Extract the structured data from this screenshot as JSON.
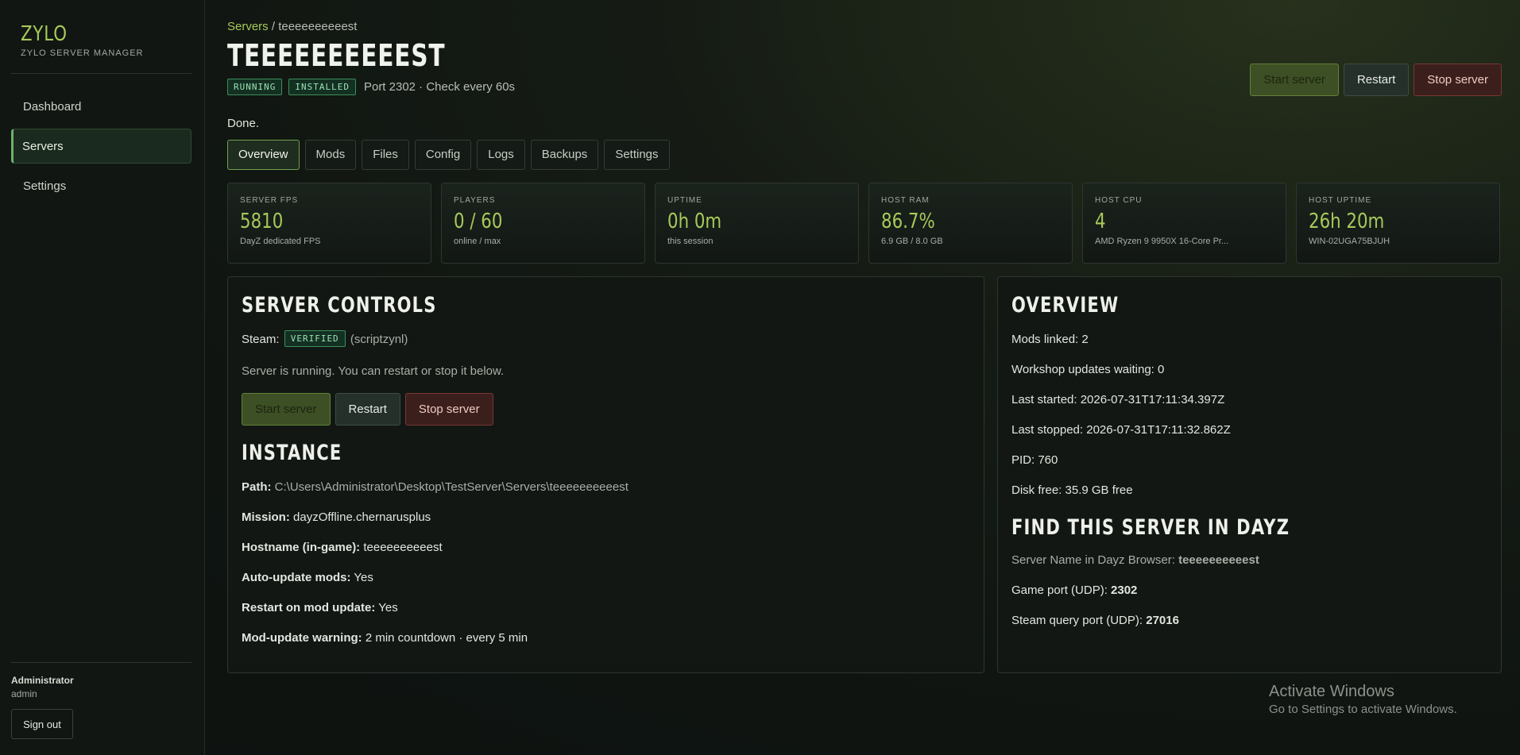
{
  "brand": {
    "name": "ZYLO",
    "subtitle": "ZYLO SERVER MANAGER"
  },
  "sidebar": {
    "items": [
      {
        "label": "Dashboard",
        "active": false
      },
      {
        "label": "Servers",
        "active": true
      },
      {
        "label": "Settings",
        "active": false
      }
    ]
  },
  "user": {
    "name": "Administrator",
    "role": "admin",
    "signout_label": "Sign out"
  },
  "breadcrumb": {
    "root": "Servers",
    "sep": "/",
    "current": "teeeeeeeeeest"
  },
  "server": {
    "title": "TEEEEEEEEEEST",
    "badges": [
      "RUNNING",
      "INSTALLED"
    ],
    "port_info": "Port 2302 · Check every 60s"
  },
  "actions": {
    "start": "Start server",
    "restart": "Restart",
    "stop": "Stop server"
  },
  "status_message": "Done.",
  "tabs": [
    "Overview",
    "Mods",
    "Files",
    "Config",
    "Logs",
    "Backups",
    "Settings"
  ],
  "stats": [
    {
      "label": "SERVER FPS",
      "value": "5810",
      "sub": "DayZ dedicated FPS"
    },
    {
      "label": "PLAYERS",
      "value": "0 / 60",
      "sub": "online / max"
    },
    {
      "label": "UPTIME",
      "value": "0h 0m",
      "sub": "this session"
    },
    {
      "label": "HOST RAM",
      "value": "86.7%",
      "sub": "6.9 GB / 8.0 GB"
    },
    {
      "label": "HOST CPU",
      "value": "4",
      "sub": "AMD Ryzen 9 9950X 16-Core Pr..."
    },
    {
      "label": "HOST UPTIME",
      "value": "26h 20m",
      "sub": "WIN-02UGA75BJUH"
    }
  ],
  "controls": {
    "heading": "SERVER CONTROLS",
    "steam_label": "Steam:",
    "steam_badge": "VERIFIED",
    "steam_user": "(scriptzynl)",
    "message": "Server is running. You can restart or stop it below."
  },
  "instance": {
    "heading": "INSTANCE",
    "path_label": "Path:",
    "path": "C:\\Users\\Administrator\\Desktop\\TestServer\\Servers\\teeeeeeeeeest",
    "mission_label": "Mission:",
    "mission": "dayzOffline.chernarusplus",
    "hostname_label": "Hostname (in-game):",
    "hostname": "teeeeeeeeeest",
    "autoupdate_label": "Auto-update mods:",
    "autoupdate": "Yes",
    "restart_label": "Restart on mod update:",
    "restart": "Yes",
    "warning_label": "Mod-update warning:",
    "warning": "2 min countdown · every 5 min"
  },
  "overview": {
    "heading": "OVERVIEW",
    "mods_linked": "Mods linked: 2",
    "workshop": "Workshop updates waiting: 0",
    "last_started": "Last started: 2026-07-31T17:11:34.397Z",
    "last_stopped": "Last stopped: 2026-07-31T17:11:32.862Z",
    "pid": "PID: 760",
    "disk": "Disk free: 35.9 GB free"
  },
  "find": {
    "heading": "FIND THIS SERVER IN DAYZ",
    "browser_label": "Server Name in Dayz Browser:",
    "browser_value": "teeeeeeeeeest",
    "game_port_label": "Game port (UDP):",
    "game_port": "2302",
    "query_port_label": "Steam query port (UDP):",
    "query_port": "27016"
  },
  "watermark": {
    "title": "Activate Windows",
    "sub": "Go to Settings to activate Windows."
  }
}
